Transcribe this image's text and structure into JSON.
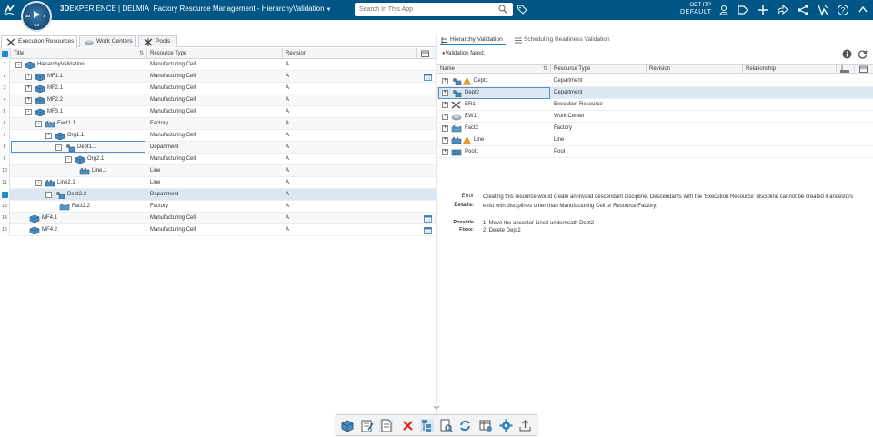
{
  "topbar": {
    "brand_prefix": "3D",
    "brand_main": "EXPERIENCE | DELMIA",
    "app_title": "Factory Resource Management - HierarchyValidation",
    "search_placeholder": "Search In This App",
    "user_line1": "ODT ITP",
    "user_line2": "DEFAULT",
    "compass_label": "V,R"
  },
  "left": {
    "tabs": [
      "Execution Resources",
      "Work Centers",
      "Pools"
    ],
    "columns": [
      "Title",
      "Resource Type",
      "Revision"
    ],
    "rows": [
      {
        "num": "1",
        "title": "HierarchyValidation",
        "type": "Manufacturing Cell",
        "rev": "A"
      },
      {
        "num": "2",
        "title": "MF1.1",
        "type": "Manufacturing Cell",
        "rev": "A"
      },
      {
        "num": "3",
        "title": "MF2.1",
        "type": "Manufacturing Cell",
        "rev": "A"
      },
      {
        "num": "4",
        "title": "MF2.2",
        "type": "Manufacturing Cell",
        "rev": "A"
      },
      {
        "num": "5",
        "title": "MF3.1",
        "type": "Manufacturing Cell",
        "rev": "A"
      },
      {
        "num": "6",
        "title": "Fact1.1",
        "type": "Factory",
        "rev": "A"
      },
      {
        "num": "7",
        "title": "Org1.1",
        "type": "Manufacturing Cell",
        "rev": "A"
      },
      {
        "num": "8",
        "title": "Dept1.1",
        "type": "Department",
        "rev": "A"
      },
      {
        "num": "9",
        "title": "Org2.1",
        "type": "Manufacturing Cell",
        "rev": "A"
      },
      {
        "num": "10",
        "title": "Line.1",
        "type": "Line",
        "rev": "A"
      },
      {
        "num": "11",
        "title": "Line2.1",
        "type": "Line",
        "rev": "A"
      },
      {
        "num": "12",
        "title": "Dept2.2",
        "type": "Department",
        "rev": "A"
      },
      {
        "num": "13",
        "title": "Fact2.2",
        "type": "Factory",
        "rev": "A"
      },
      {
        "num": "14",
        "title": "MF4.1",
        "type": "Manufacturing Cell",
        "rev": "A"
      },
      {
        "num": "15",
        "title": "MF4.2",
        "type": "Manufacturing Cell",
        "rev": "A"
      }
    ]
  },
  "right": {
    "tabs": [
      "Hierarchy Validation",
      "Scheduling Readiness Validation"
    ],
    "validation_message": "Validation failed.",
    "columns": [
      "Name",
      "Resource Type",
      "Revision",
      "Relationship"
    ],
    "rows": [
      {
        "name": "Dept1",
        "type": "Department"
      },
      {
        "name": "Dept2",
        "type": "Department"
      },
      {
        "name": "ER1",
        "type": "Execution Resource"
      },
      {
        "name": "EW1",
        "type": "Work Center"
      },
      {
        "name": "Fact2",
        "type": "Factory"
      },
      {
        "name": "Line",
        "type": "Line"
      },
      {
        "name": "Pool1",
        "type": "Pool"
      }
    ],
    "error_label": "Error",
    "details_label": "Details:",
    "details_line1": "Creating this resource would create an invalid descendant discipline. Descendants with the 'Execution Resource' discipline cannot be created if ancestors",
    "details_line2": "exist with disciplines other than Manufacturing Cell or Resource Factory.",
    "fixes_label_1": "Possible",
    "fixes_label_2": "Fixes:",
    "fix_1": "1. Move the ancestor Line2 underneath Dept2",
    "fix_2": "2. Delete Dept2"
  },
  "colors": {
    "topbar": "#005686",
    "accent": "#1e88c8",
    "selected_row": "#dbe8f3",
    "warning": "#f0a020",
    "error": "#dd2222"
  }
}
